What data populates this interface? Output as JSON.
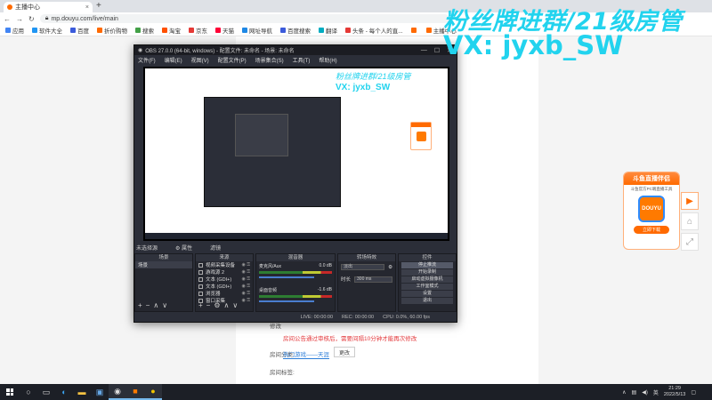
{
  "browser": {
    "tab_title": "主播中心",
    "tab_close": "×",
    "new_tab": "+",
    "url": "mp.douyu.com/live/main",
    "bookmarks": [
      {
        "label": "应用",
        "color": "#4285f4"
      },
      {
        "label": "软件大全",
        "color": "#2196f3"
      },
      {
        "label": "百度",
        "color": "#3b5bdb"
      },
      {
        "label": "折价购物",
        "color": "#ff6a00"
      },
      {
        "label": "搜索",
        "color": "#43a047"
      },
      {
        "label": "淘宝",
        "color": "#ff5000"
      },
      {
        "label": "京东",
        "color": "#e53935"
      },
      {
        "label": "天猫",
        "color": "#ff0036"
      },
      {
        "label": "网址导航",
        "color": "#1e88e5"
      },
      {
        "label": "百度搜索",
        "color": "#3b5bdb"
      },
      {
        "label": "翻译",
        "color": "#00acc1"
      },
      {
        "label": "头条 - 每个人的直...",
        "color": "#e53935"
      },
      {
        "label": "",
        "color": "#ff6a00"
      },
      {
        "label": "主播中心",
        "color": "#ff6a00"
      }
    ]
  },
  "watermark": {
    "line1": "粉丝牌进群/21级房管",
    "line2": "VX: jyxb_SW"
  },
  "page": {
    "notice": "房间公告通过审核后，需要间隔10分钟才能再次修改",
    "category_label": "房间分类:",
    "category_value": "热门游戏——天涯",
    "change_button": "更改",
    "label_label": "房间标签:",
    "section_label": "修改"
  },
  "ad": {
    "title": "斗鱼直播伴侣",
    "subtitle": "斗鱼官方PC端直播工具",
    "logo_text": "DOUYU",
    "download": "立即下载"
  },
  "obs": {
    "title": "OBS 27.0.0 (64-bit, windows) - 配置文件: 未命名 - 场景: 未命名",
    "menu": [
      "文件(F)",
      "编辑(E)",
      "视图(V)",
      "配置文件(P)",
      "场景集合(S)",
      "工具(T)",
      "帮助(H)"
    ],
    "scene_bar_label": "未选择源",
    "scene_bar_props": "⚙ 属性",
    "scene_bar_filters": "滤镜",
    "docks": {
      "scenes": "场景",
      "sources": "来源",
      "mixer": "混音器",
      "transitions": "转场特效",
      "controls": "控件"
    },
    "scene_items": [
      "场景"
    ],
    "sources": [
      "视频采集设备",
      "游戏源 2",
      "文本 (GDI+)",
      "文本 (GDI+)",
      "浏览器",
      "窗口采集"
    ],
    "mixer": [
      {
        "name": "麦克风/Aux",
        "db": "0.0 dB"
      },
      {
        "name": "桌面音频",
        "db": "-1.6 dB"
      }
    ],
    "transition_type": "淡出",
    "duration_label": "时长",
    "duration_value": "300 ms",
    "controls": [
      "停止推流",
      "开始录制",
      "启动虚拟摄像机",
      "工作室模式",
      "设置",
      "退出"
    ],
    "status": {
      "drop": "LIVE: 00:00:00",
      "rec": "REC: 00:00:00",
      "cpu": "CPU: 0.0%, 60.00 fps"
    }
  },
  "taskbar": {
    "tray_text": "英",
    "time": "21:29",
    "date": "2022/5/13"
  }
}
